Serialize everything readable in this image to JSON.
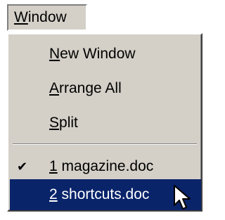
{
  "menu": {
    "title": {
      "access_key": "W",
      "rest": "indow"
    },
    "items": [
      {
        "access_key": "N",
        "rest": "ew Window"
      },
      {
        "access_key": "A",
        "rest": "rrange All"
      },
      {
        "access_key": "S",
        "rest": "plit"
      }
    ],
    "windows": [
      {
        "number": "1",
        "rest": " magazine.doc",
        "checked": true,
        "check_glyph": "✔"
      },
      {
        "number": "2",
        "rest": " shortcuts.doc",
        "checked": false,
        "highlighted": true
      }
    ]
  },
  "icons": [
    "checkmark-icon",
    "mouse-pointer-icon"
  ],
  "colors": {
    "menu_face": "#d4d0c8",
    "highlight": "#0a246a",
    "highlight_text": "#ffffff"
  }
}
